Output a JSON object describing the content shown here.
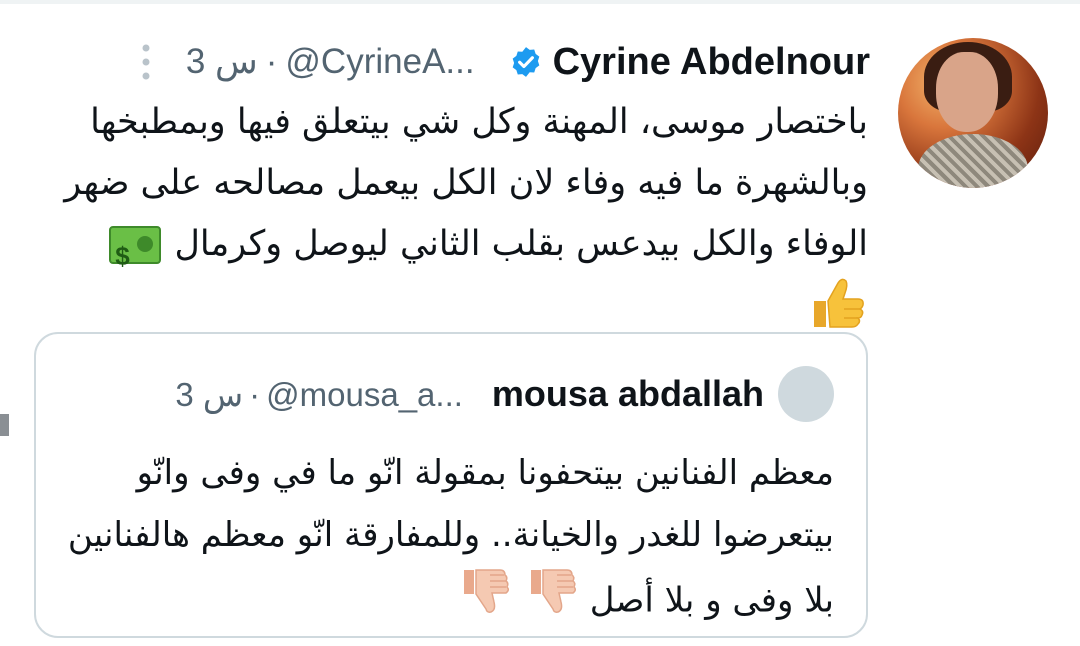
{
  "tweet": {
    "author_name": "Cyrine Abdelnour",
    "author_handle": "@CyrineA...",
    "separator": "·",
    "time": "3 س",
    "text": "باختصار موسى، المهنة وكل شي بيتعلق فيها وبمطبخها وبالشهرة ما فيه وفاء لان الكل بيعمل مصالحه على ضهر الوفاء والكل بيدعس بقلب الثاني ليوصل وكرمال",
    "emojis": [
      "money-with-wings",
      "thumbs-up"
    ]
  },
  "quoted_tweet": {
    "author_name": "mousa abdallah",
    "author_handle": "@mousa_a...",
    "separator": "·",
    "time": "3 س",
    "text": "معظم الفنانين بيتحفونا بمقولة انّو ما في وفى وانّو بيتعرضوا للغدر والخيانة.. وللمفارقة انّو معظم هالفنانين بلا وفى و بلا أصل",
    "emojis": [
      "thumbs-down",
      "thumbs-down"
    ]
  },
  "colors": {
    "text": "#0f1419",
    "secondary": "#536471",
    "verified": "#1d9bf0",
    "border": "#cfd9de",
    "thumb_up": "#f7c23b",
    "thumb_down": "#f5c9b2"
  }
}
